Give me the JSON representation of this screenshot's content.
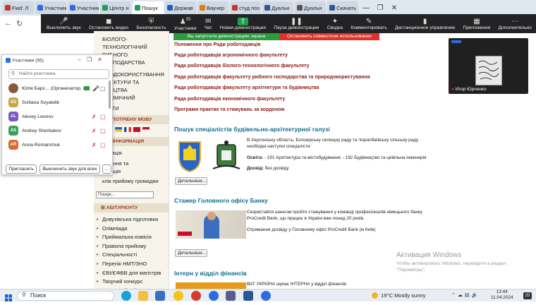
{
  "browser": {
    "tabs": [
      "Fwd: Л",
      "Участник",
      "Участник",
      "Центр н",
      "Пошук",
      "Держав",
      "Ваучер",
      "студ поз",
      "Дуальн",
      "Дуальн",
      "Скачать"
    ],
    "window_controls": [
      "—",
      "❐",
      "✕"
    ]
  },
  "zoom": {
    "participants_count": "55",
    "toolbar": [
      "Выключить звук",
      "Остановить видео",
      "Безопасность",
      "Участники",
      "Чат",
      "Новая демонстрация",
      "Пауза демонстрации",
      "Сводка",
      "Комментировать",
      "Дистанционное управление",
      "Приложения",
      "Дополнительно"
    ],
    "share_banner": "Вы запустили демонстрацию экрана",
    "stop_share": "Остановить совместное использование",
    "video_name": "Игор Юрченко",
    "panel": {
      "title": "Участники (55)",
      "search_placeholder": "Найти участника",
      "participants": [
        {
          "initials": "",
          "name": "Юлія Барс... (Организатор, я)",
          "color": "#8a5a3a"
        },
        {
          "initials": "SS",
          "name": "Svitlana Svyatelik",
          "color": "#caa64a"
        },
        {
          "initials": "AL",
          "name": "Alexey Leonov",
          "color": "#7b57c7"
        },
        {
          "initials": "AS",
          "name": "Andrey Sherbakov",
          "color": "#3aa05a"
        },
        {
          "initials": "AR",
          "name": "Anna Romanchuk",
          "color": "#d86a30"
        }
      ],
      "invite": "Пригласить",
      "mute_all": "Выключить звук для всех",
      "more": "..."
    }
  },
  "site": {
    "leftnav_top": [
      "БІОЛОГО-",
      "ТЕХНОЛОГІЧНИЙ",
      "РИБНОГО ГОСПОДАРСТВА",
      "",
      "ПРОДОКОРИСТУВАННЯ",
      "ХІТЕКТУРИ ТА",
      "ВНИЦТВА",
      "ОНОМІЧНИЙ",
      "",
      "ТАКТИ"
    ],
    "lang_head": "ИТЬ ПОТРІБНУ МОВУ",
    "info_head": "ЧНА ІНФОРМАЦІЯ",
    "info_items": [
      "ормація",
      "",
      "кування та",
      "дитація",
      "",
      "клік прийому громадян"
    ],
    "search_placeholder": "Пошук...",
    "abit_head": "АБІТУРІЄНТУ",
    "abit_items": [
      "Довузівська підготовка",
      "Олімпіада",
      "Приймальна комісія",
      "Правила прийому",
      "Спеціальності",
      "Перелік НМТ/ЗНО",
      "ЄВІ/ЄФВВ для магістрів",
      "Творчий конкурс",
      "Мотиваційний лист"
    ],
    "links": [
      "Положення про Ради роботодавців",
      "Рада роботодавців агрономічного факультету",
      "Рада роботодавців біолого-технологічного факультету",
      "Рада роботодавців факультету рибного господарства та природокористування",
      "Рада роботодавців факультету архітектури та будівництва",
      "Рада роботодавців економічного факультету",
      "Програми практик та стажувань за кордоном"
    ],
    "post1": {
      "title": "Пошук спеціалістів будівельно-архітектурної галузі",
      "text": "В Херсонську область, Білозерську селищну раду та Чорнобаївську сільську раду необхідні наступні спеціалісти:",
      "edu_label": "Освіта:",
      "edu": " - 191 Архітектура та містобудування; - 192 Будівництво та цивільна інженерія",
      "exp_label": "Досвід:",
      "exp": " без досвіду",
      "more": "Детальніше..."
    },
    "post2": {
      "title": "Стажер Головного офісу Банку",
      "text": "Скористайся шансом пройти стажування у команді професіоналів німецького банку ProCredit Bank, що працює в Україні вже понад 20 років.",
      "text2": "Отримання досвіду у Головному офісі ProCredit Bank (м Київ)",
      "more": "Детальніше..."
    },
    "post3": {
      "title": "Інтерн у відділ фінансів",
      "text": "ВАТ УКРАЇНА шукає ІНТЕРНА у відділ фінансів."
    }
  },
  "watermark": {
    "line1": "Активация Windows",
    "line2": "Чтобы активировать Windows, перейдите в раздел \"Параметры\"."
  },
  "taskbar": {
    "search": "Поиск",
    "weather": "19°C  Mostly sunny",
    "time": "13:44",
    "date": "11.04.2024",
    "notif": "20"
  }
}
